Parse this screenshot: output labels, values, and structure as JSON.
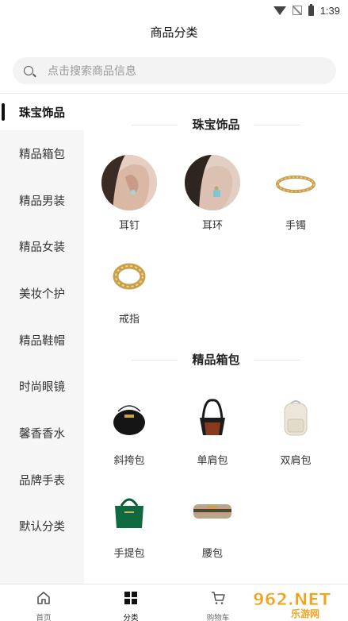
{
  "status_bar": {
    "time": "1:39"
  },
  "header": {
    "title": "商品分类"
  },
  "search": {
    "placeholder": "点击搜索商品信息"
  },
  "sidebar": {
    "items": [
      {
        "label": "珠宝饰品",
        "active": true
      },
      {
        "label": "精品箱包"
      },
      {
        "label": "精品男装"
      },
      {
        "label": "精品女装"
      },
      {
        "label": "美妆个护"
      },
      {
        "label": "精品鞋帽"
      },
      {
        "label": "时尚眼镜"
      },
      {
        "label": "馨香香水"
      },
      {
        "label": "品牌手表"
      },
      {
        "label": "默认分类"
      }
    ]
  },
  "sections": [
    {
      "title": "珠宝饰品",
      "items": [
        {
          "label": "耳钉",
          "icon": "earring-stud-photo"
        },
        {
          "label": "耳环",
          "icon": "earring-photo"
        },
        {
          "label": "手镯",
          "icon": "bracelet-image"
        },
        {
          "label": "戒指",
          "icon": "ring-image"
        }
      ]
    },
    {
      "title": "精品箱包",
      "items": [
        {
          "label": "斜挎包",
          "icon": "crossbody-bag-image"
        },
        {
          "label": "单肩包",
          "icon": "shoulder-bag-image"
        },
        {
          "label": "双肩包",
          "icon": "backpack-image"
        },
        {
          "label": "手提包",
          "icon": "handbag-image"
        },
        {
          "label": "腰包",
          "icon": "waist-bag-image"
        }
      ]
    }
  ],
  "bottom_nav": {
    "tabs": [
      {
        "label": "首页",
        "icon": "home-icon"
      },
      {
        "label": "分类",
        "icon": "category-grid-icon",
        "active": true
      },
      {
        "label": "购物车",
        "icon": "cart-icon"
      }
    ]
  },
  "watermark": {
    "text": "962.NET 乐游网"
  }
}
